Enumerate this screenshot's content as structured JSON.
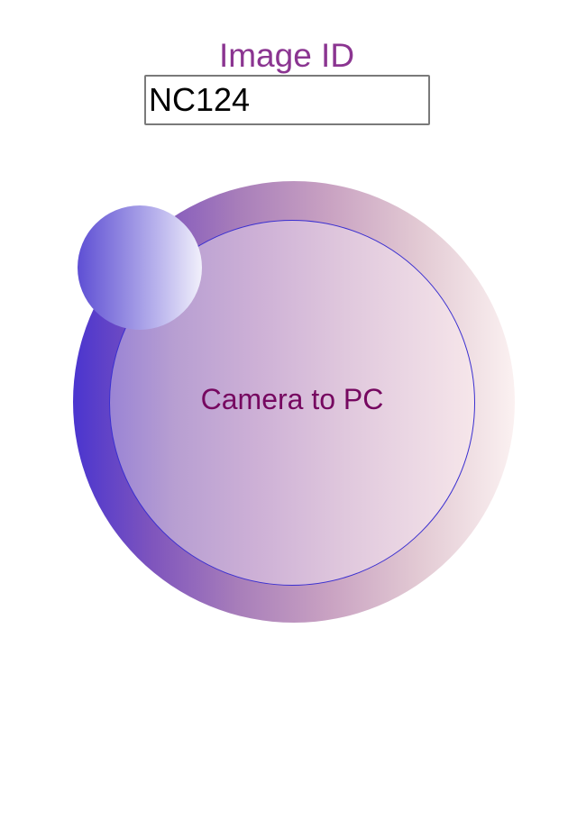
{
  "image_id": {
    "label": "Image ID",
    "value": "NC124"
  },
  "capture_button": {
    "label": "Camera to PC"
  },
  "colors": {
    "label_purple": "#8b3591",
    "button_text": "#760860",
    "ring_start": "#4a35cf",
    "ring_end": "#fbf1f1",
    "inner_border": "#3a2fd0",
    "knob_start": "#5e4fd4"
  }
}
